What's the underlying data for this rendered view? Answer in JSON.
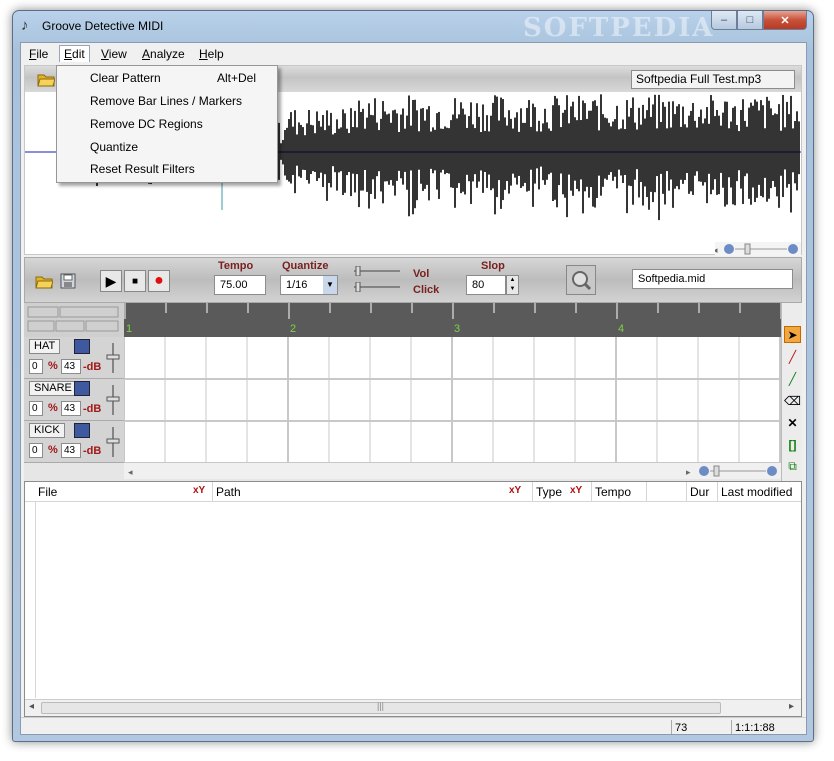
{
  "window": {
    "title": "Groove Detective MIDI",
    "watermark": "SOFTPEDIA",
    "minimize": "–",
    "maximize": "□",
    "close": "✕"
  },
  "menu": {
    "items": [
      "File",
      "Edit",
      "View",
      "Analyze",
      "Help"
    ],
    "open": "Edit"
  },
  "edit_menu": {
    "items": [
      {
        "label": "Clear Pattern",
        "shortcut": "Alt+Del"
      },
      {
        "label": "Remove Bar Lines /  Markers",
        "shortcut": ""
      },
      {
        "label": "Remove DC Regions",
        "shortcut": ""
      },
      {
        "label": "Quantize",
        "shortcut": ""
      },
      {
        "label": "Reset Result Filters",
        "shortcut": ""
      }
    ]
  },
  "audio": {
    "file": "Softpedia Full Test.mp3"
  },
  "drum_toolbar": {
    "tempo_label": "Tempo",
    "tempo_value": "75.00",
    "quantize_label": "Quantize",
    "quantize_value": "1/16",
    "vol_label": "Vol",
    "click_label": "Click",
    "slop_label": "Slop",
    "slop_value": "80",
    "midi_file": "Softpedia.mid"
  },
  "ruler": {
    "bars": [
      "1",
      "2",
      "3",
      "4"
    ]
  },
  "tracks": [
    {
      "name": "HAT",
      "offset": "0",
      "pct": "%",
      "velocity": "43",
      "db": "-dB"
    },
    {
      "name": "SNARE",
      "offset": "0",
      "pct": "%",
      "velocity": "43",
      "db": "-dB"
    },
    {
      "name": "KICK",
      "offset": "0",
      "pct": "%",
      "velocity": "43",
      "db": "-dB"
    }
  ],
  "file_list": {
    "columns": [
      "File",
      "Path",
      "Type",
      "Tempo",
      "Dur",
      "Last modified"
    ]
  },
  "status": {
    "value": "73",
    "position": "1:1:1:88"
  },
  "colors": {
    "accent_titlebar": "#b9d1ea",
    "grid_line": "#c8c8c8",
    "ruler": "#5a5a5a",
    "ruler_label": "#7fd04a",
    "record": "#e01010"
  }
}
